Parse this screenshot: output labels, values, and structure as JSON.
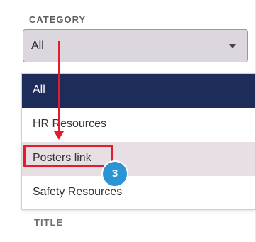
{
  "category": {
    "label": "CATEGORY",
    "selected": "All",
    "options": [
      {
        "label": "All",
        "state": "active"
      },
      {
        "label": "HR Resources",
        "state": "normal"
      },
      {
        "label": "Posters link",
        "state": "hover"
      },
      {
        "label": "Safety Resources",
        "state": "normal"
      }
    ]
  },
  "annotation": {
    "step_number": "3",
    "highlight_color": "#e21b2e",
    "badge_color": "#2a94d4"
  },
  "title_section": {
    "label": "TITLE"
  },
  "colors": {
    "active_option_bg": "#1e2c5a",
    "hover_option_bg": "#e7dfe3",
    "select_bg": "#dcd6df"
  }
}
